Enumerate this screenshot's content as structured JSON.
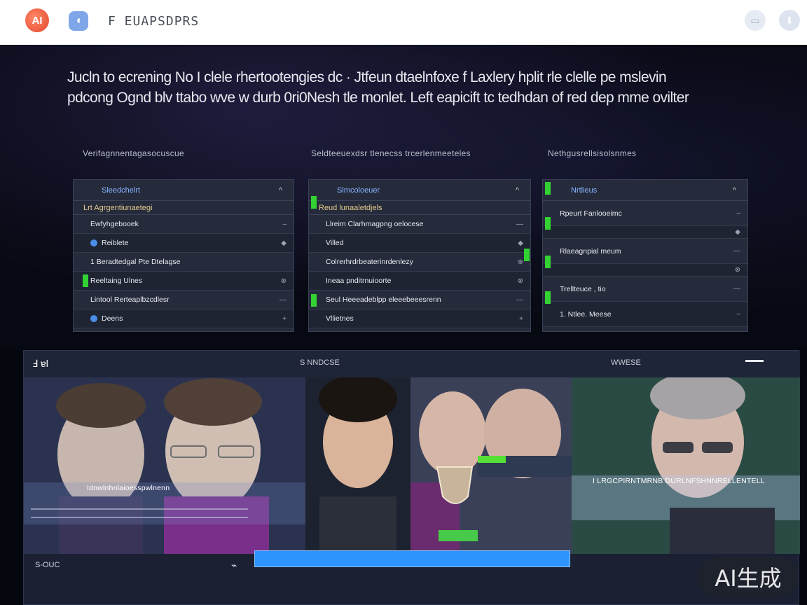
{
  "topbar": {
    "logo_left": "AI",
    "app_title": "F EUAPSDPRS",
    "icon_left": "logo-icon",
    "icon_mid": "app-icon",
    "icon_right_a": "message-icon",
    "icon_right_b": "download-icon"
  },
  "intro": "Jucln to ecrening No I clele rhertootengies dc · Jtfeun dtaelnfoxe f Laxlery hplit rle clelle pe mslevin pdcong Ognd blv ttabo wve w durb 0ri0Nesh tle monlet. Left eapicift tc tedhdan of red dep mme ovilter",
  "columns": [
    {
      "heading": "Verifagnnentagasocuscue",
      "panel_title": "Sleedchelrt",
      "sub_label": "Lrt Agrgentiunaetegi",
      "rows": [
        {
          "label": "Ewfyhgebooek",
          "action": "–"
        },
        {
          "label": "Reiblete",
          "action": "◆"
        },
        {
          "label": "1 Beradtedgal Pte Dtelagse",
          "action": ""
        },
        {
          "label": "Reeltaing Ulnes",
          "action": "⊗"
        },
        {
          "label": "Lintool Rerteaplbzcdlesr",
          "action": "—"
        },
        {
          "label": "Deens",
          "action": "+"
        }
      ]
    },
    {
      "heading": "Seldteeuexdsr tlenecss trcerlenmeeteles",
      "panel_title": "Slmcoloeuer",
      "sub_label": "Reud lunaaletdjels",
      "rows": [
        {
          "label": "Llreim Clarhmagpng oelocese",
          "action": "—"
        },
        {
          "label": "Villed",
          "action": "◆"
        },
        {
          "label": "Colrerhrdrbeaterinrdenlezy",
          "action": "⊕"
        },
        {
          "label": "Ineaa pnditrnuioorte",
          "action": "⊗"
        },
        {
          "label": "Seul Heeeadeblpp eleeebeeesrenn",
          "action": "—"
        },
        {
          "label": "Vllietnes",
          "action": "+"
        }
      ]
    },
    {
      "heading": "Nethgusrellsisolsnmes",
      "panel_title": "Nrtlieus",
      "sub_label": "",
      "rows": [
        {
          "label": "Rpeurt Fanlooeimc",
          "action": "–"
        },
        {
          "label": "",
          "action": "◆"
        },
        {
          "label": "Rlaeagnpial meum",
          "action": "—"
        },
        {
          "label": "",
          "action": "⊗"
        },
        {
          "label": "Trellteuce , tio",
          "action": "—"
        },
        {
          "label": "1. Ntlee. Meese",
          "action": "–"
        }
      ]
    }
  ],
  "viewer": {
    "left_label": "Ⅎ ɐl",
    "mid_label": "S NNDCSE",
    "right_label": "WWESE",
    "tile_caption_1": "Idnwlnhnlaioesspwlnenn",
    "tile_caption_2": "I LRGCPIRNTMRNB DURLNFSHNNRELLENTELL",
    "scrub_label": "S-OUC",
    "scrub_icon": "⌁"
  },
  "watermark": "AI生成"
}
